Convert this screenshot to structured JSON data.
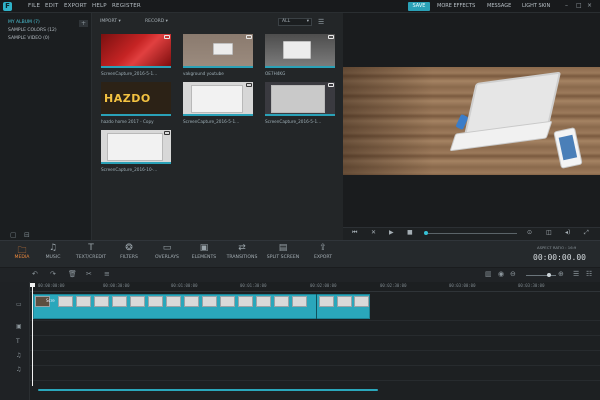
{
  "menu": {
    "logo": "F",
    "items": [
      "FILE",
      "EDIT",
      "EXPORT",
      "HELP",
      "REGISTER"
    ],
    "save": "SAVE",
    "more_effects": "MORE EFFECTS",
    "message": "MESSAGE",
    "light_skin": "LIGHT SKIN"
  },
  "library": {
    "albums": [
      "MY ALBUM (7)",
      "SAMPLE COLORS (12)",
      "SAMPLE VIDEO (0)"
    ],
    "add": "+"
  },
  "media": {
    "import": "IMPORT ▾",
    "record": "RECORD ▾",
    "filter": "ALL",
    "items": [
      {
        "label": "ScreenCapture_2016-5-1..."
      },
      {
        "label": "vakground youtube"
      },
      {
        "label": "OE7H4KG"
      },
      {
        "label": "hazdo home 2017 - Copy"
      },
      {
        "label": "ScreenCapture_2016-5-1..."
      },
      {
        "label": "ScreenCapture_2016-5-1..."
      },
      {
        "label": "ScreenCapture_2016-10-..."
      }
    ],
    "thumb4_text": "HAZDO"
  },
  "effects": [
    {
      "label": "MEDIA",
      "icon": "folder-icon",
      "glyph": "🗀"
    },
    {
      "label": "MUSIC",
      "icon": "music-icon",
      "glyph": "♫"
    },
    {
      "label": "TEXT/CREDIT",
      "icon": "text-icon",
      "glyph": "T"
    },
    {
      "label": "FILTERS",
      "icon": "filters-icon",
      "glyph": "❂"
    },
    {
      "label": "OVERLAYS",
      "icon": "overlays-icon",
      "glyph": "▭"
    },
    {
      "label": "ELEMENTS",
      "icon": "elements-icon",
      "glyph": "▣"
    },
    {
      "label": "TRANSITIONS",
      "icon": "transitions-icon",
      "glyph": "⇄"
    },
    {
      "label": "SPLIT SCREEN",
      "icon": "split-screen-icon",
      "glyph": "▤"
    },
    {
      "label": "EXPORT",
      "icon": "export-icon",
      "glyph": "⇪"
    }
  ],
  "preview": {
    "aspect_ratio": "ASPECT RATIO : 16:9",
    "timecode": "00:00:00.00"
  },
  "timeline": {
    "ticks": [
      "00:00:00:00",
      "00:00:30:00",
      "00:01:00:00",
      "00:01:30:00",
      "00:02:00:00",
      "00:02:30:00",
      "00:03:00:00",
      "00:03:30:00"
    ],
    "clip_label": "Scre"
  },
  "colors": {
    "accent": "#2aa1b7",
    "active_tab": "#ef8a3d"
  }
}
